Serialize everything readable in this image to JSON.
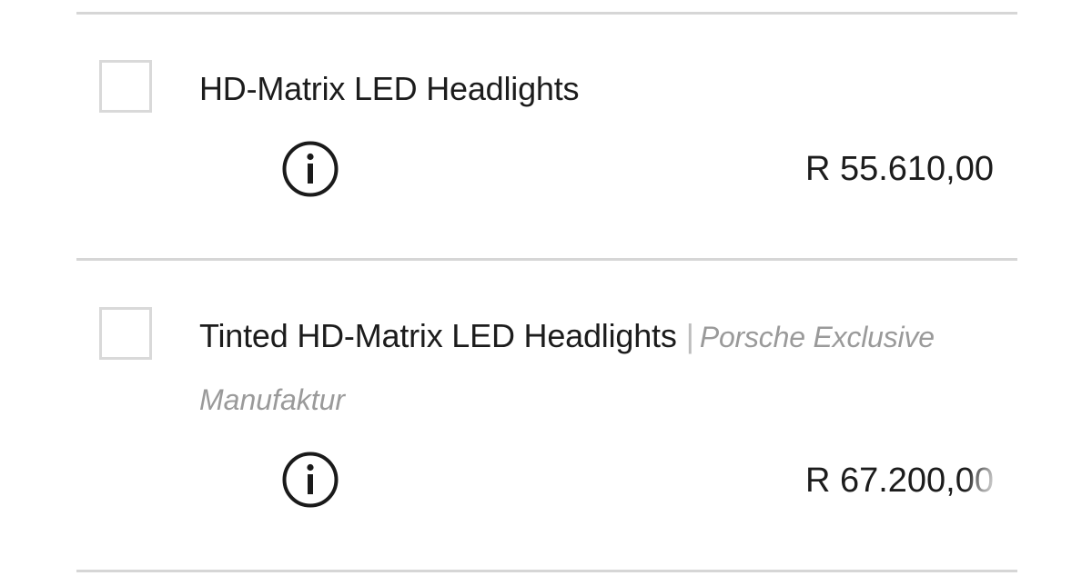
{
  "options": [
    {
      "title": "HD-Matrix LED Headlights",
      "subtitle_inline": "",
      "subtitle_wrap": "",
      "price": "R 55.610,00",
      "checked": false,
      "info_icon": "info-circle-icon"
    },
    {
      "title": "Tinted HD-Matrix LED Headlights",
      "separator": "|",
      "subtitle_inline": "Porsche Exclusive",
      "subtitle_wrap": "Manufaktur",
      "price": "R 67.200,00",
      "checked": false,
      "info_icon": "info-circle-icon"
    }
  ],
  "colors": {
    "divider": "#d6d6d6",
    "checkbox_border": "#d9d9d9",
    "text": "#1c1c1c",
    "muted": "#9a9a9a"
  }
}
